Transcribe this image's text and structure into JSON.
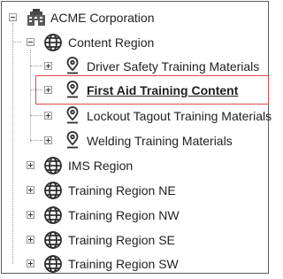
{
  "tree": {
    "root": {
      "label": "ACME Corporation",
      "icon": "building-icon",
      "expanded": true
    },
    "regions": [
      {
        "label": "Content Region",
        "icon": "globe-icon",
        "expanded": true,
        "items": [
          {
            "label": "Driver Safety Training Materials",
            "icon": "map-pin-icon",
            "selected": false
          },
          {
            "label": "First Aid Training Content",
            "icon": "map-pin-icon",
            "selected": true
          },
          {
            "label": "Lockout Tagout Training Materials",
            "icon": "map-pin-icon",
            "selected": false
          },
          {
            "label": "Welding Training Materials",
            "icon": "map-pin-icon",
            "selected": false
          }
        ]
      },
      {
        "label": "IMS Region",
        "icon": "globe-icon",
        "expanded": false
      },
      {
        "label": "Training Region NE",
        "icon": "globe-icon",
        "expanded": false
      },
      {
        "label": "Training Region NW",
        "icon": "globe-icon",
        "expanded": false
      },
      {
        "label": "Training Region SE",
        "icon": "globe-icon",
        "expanded": false
      },
      {
        "label": "Training Region SW",
        "icon": "globe-icon",
        "expanded": false
      }
    ]
  },
  "colors": {
    "highlight_border": "#e04a4a",
    "tree_lines": "#9a9a9a",
    "text": "#1f1f1f"
  }
}
